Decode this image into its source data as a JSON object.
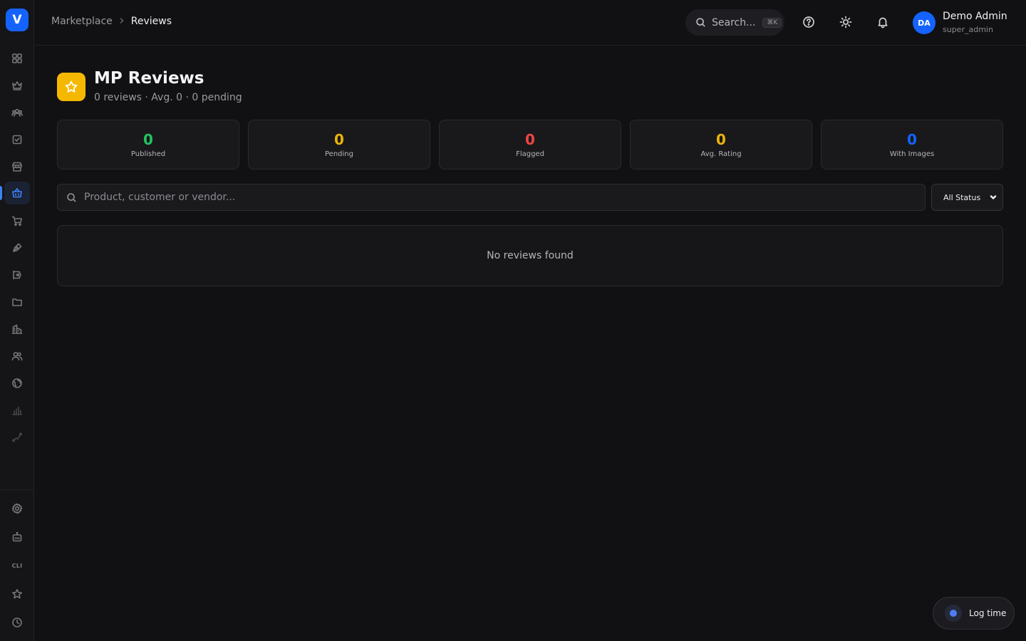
{
  "app": {
    "logo_letter": "V"
  },
  "sidebar": {
    "items": [
      {
        "icon": "dashboard-grid-icon"
      },
      {
        "icon": "crown-icon"
      },
      {
        "icon": "team-icon"
      },
      {
        "icon": "task-check-icon"
      },
      {
        "icon": "store-icon"
      },
      {
        "icon": "shopping-bag-icon",
        "active": true
      },
      {
        "icon": "cart-icon"
      },
      {
        "icon": "pen-tool-icon"
      },
      {
        "icon": "campaign-icon"
      },
      {
        "icon": "folder-icon"
      },
      {
        "icon": "building-icon"
      },
      {
        "icon": "users-icon"
      },
      {
        "icon": "globe-icon"
      },
      {
        "icon": "bar-chart-icon"
      },
      {
        "icon": "trend-icon"
      }
    ],
    "bottom_items": [
      {
        "icon": "settings-gear-icon"
      },
      {
        "icon": "robot-icon"
      },
      {
        "icon": "cli-icon",
        "label": "CLI"
      },
      {
        "icon": "star-icon"
      },
      {
        "icon": "clock-icon"
      }
    ]
  },
  "header": {
    "breadcrumb": {
      "parent": "Marketplace",
      "current": "Reviews"
    },
    "search": {
      "placeholder": "Search...",
      "shortcut": "⌘K"
    },
    "user": {
      "initials": "DA",
      "name": "Demo Admin",
      "role": "super_admin"
    }
  },
  "page": {
    "title": "MP Reviews",
    "subtitle": "0 reviews · Avg. 0 · 0 pending"
  },
  "stats": [
    {
      "value": "0",
      "label": "Published",
      "color": "#22c55e"
    },
    {
      "value": "0",
      "label": "Pending",
      "color": "#eab308"
    },
    {
      "value": "0",
      "label": "Flagged",
      "color": "#ef4444"
    },
    {
      "value": "0",
      "label": "Avg. Rating",
      "color": "#eab308"
    },
    {
      "value": "0",
      "label": "With Images",
      "color": "#1463ff"
    }
  ],
  "filters": {
    "search_placeholder": "Product, customer or vendor...",
    "status_value": "All Status"
  },
  "empty_state": {
    "message": "No reviews found"
  },
  "log_time": {
    "label": "Log time"
  }
}
